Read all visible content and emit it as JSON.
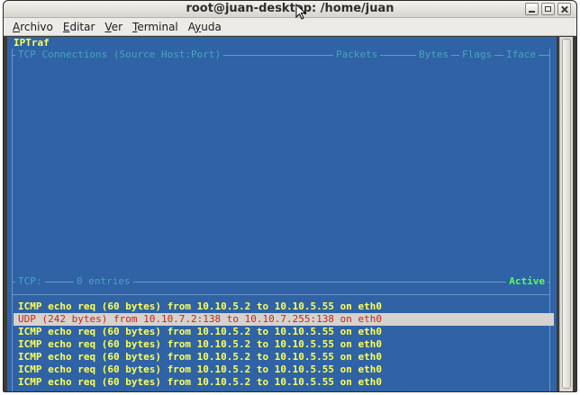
{
  "window": {
    "title": "root@juan-desktop: /home/juan"
  },
  "menubar": {
    "items": [
      {
        "label": "Archivo",
        "underline": "A",
        "rest": "rchivo"
      },
      {
        "label": "Editar",
        "underline": "E",
        "rest": "ditar"
      },
      {
        "label": "Ver",
        "underline": "V",
        "rest": "er"
      },
      {
        "label": "Terminal",
        "underline": "T",
        "rest": "erminal"
      },
      {
        "label": "Ayuda",
        "underline": "y",
        "pre": "A",
        "rest": "uda"
      }
    ]
  },
  "iptraf": {
    "app_title": "IPTraf",
    "tcp_header": {
      "connections": "TCP Connections (Source Host:Port)",
      "packets": "Packets",
      "bytes": "Bytes",
      "flags": "Flags",
      "iface": "Iface"
    },
    "tcp_footer": {
      "label": "TCP:",
      "entries": "0 entries",
      "status": "Active"
    },
    "log_lines": [
      {
        "text": "ICMP echo req (60 bytes) from 10.10.5.2 to 10.10.5.55 on eth0",
        "selected": false
      },
      {
        "text": "UDP (242 bytes) from 10.10.7.2:138 to 10.10.7.255:138 on eth0",
        "selected": true
      },
      {
        "text": "ICMP echo req (60 bytes) from 10.10.5.2 to 10.10.5.55 on eth0",
        "selected": false
      },
      {
        "text": "ICMP echo req (60 bytes) from 10.10.5.2 to 10.10.5.55 on eth0",
        "selected": false
      },
      {
        "text": "ICMP echo req (60 bytes) from 10.10.5.2 to 10.10.5.55 on eth0",
        "selected": false
      },
      {
        "text": "ICMP echo req (60 bytes) from 10.10.5.2 to 10.10.5.55 on eth0",
        "selected": false
      },
      {
        "text": "ICMP echo req (60 bytes) from 10.10.5.2 to 10.10.5.55 on eth0",
        "selected": false
      }
    ]
  },
  "colors": {
    "terminal_bg": "#2f63a5",
    "highlight_yellow": "#ffff55",
    "header_cyan": "#49a2bf",
    "active_green": "#55ff55",
    "selected_row_bg": "#d6d2cd",
    "selected_row_text": "#c4261c"
  },
  "icons": {
    "minimize": "minimize-icon",
    "maximize": "maximize-icon",
    "close": "close-icon",
    "cursor": "mouse-pointer-icon"
  }
}
